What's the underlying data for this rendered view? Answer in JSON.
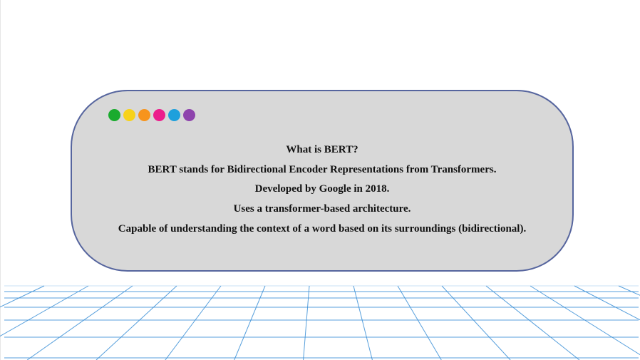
{
  "slide": {
    "dots": [
      {
        "name": "green-dot",
        "color": "#1aab2e"
      },
      {
        "name": "yellow-dot",
        "color": "#f7d21a"
      },
      {
        "name": "orange-dot",
        "color": "#f7941d"
      },
      {
        "name": "pink-dot",
        "color": "#ec1e8c"
      },
      {
        "name": "blue-dot",
        "color": "#1ea0dc"
      },
      {
        "name": "purple-dot",
        "color": "#8e44ad"
      }
    ],
    "title": "What is BERT?",
    "lines": [
      "BERT stands for Bidirectional Encoder Representations from Transformers.",
      "Developed by Google in 2018.",
      "Uses a transformer-based architecture.",
      "Capable of understanding the context of a word based on its surroundings (bidirectional)."
    ],
    "colors": {
      "card_fill": "#d8d8d8",
      "card_border": "#56659e",
      "grid_line": "#3a8fd6",
      "text": "#111111"
    }
  }
}
